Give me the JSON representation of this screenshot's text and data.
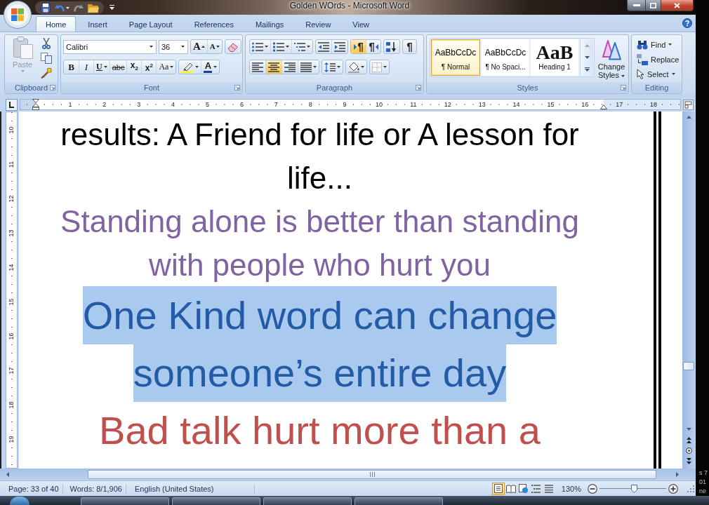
{
  "window": {
    "title": "Golden WOrds - Microsoft Word"
  },
  "quick_access": [
    {
      "kind": "save",
      "disabled": false,
      "dropdown": false
    },
    {
      "kind": "undo",
      "disabled": false,
      "dropdown": true
    },
    {
      "kind": "redo",
      "disabled": true,
      "dropdown": false
    },
    {
      "kind": "open",
      "disabled": false,
      "dropdown": false
    }
  ],
  "tabs": [
    {
      "label": "Home",
      "selected": true
    },
    {
      "label": "Insert",
      "selected": false
    },
    {
      "label": "Page Layout",
      "selected": false
    },
    {
      "label": "References",
      "selected": false
    },
    {
      "label": "Mailings",
      "selected": false
    },
    {
      "label": "Review",
      "selected": false
    },
    {
      "label": "View",
      "selected": false
    }
  ],
  "ribbon": {
    "clipboard": {
      "label": "Clipboard",
      "paste": {
        "label": "Paste",
        "disabled": true
      }
    },
    "font": {
      "label": "Font",
      "font_name": "Calibri",
      "font_size": "36",
      "size_buttons": [
        {
          "kind": "grow",
          "text": "A"
        },
        {
          "kind": "shrink",
          "text": "A"
        }
      ],
      "format_buttons": [
        {
          "kind": "bold",
          "text": "B",
          "dropdown": false
        },
        {
          "kind": "italic",
          "text": "I",
          "dropdown": false
        },
        {
          "kind": "underline",
          "text": "U",
          "dropdown": true
        },
        {
          "kind": "strikethrough",
          "text": "abc",
          "dropdown": false
        },
        {
          "kind": "subscript",
          "text": "x$_{2}$",
          "dropdown": false
        },
        {
          "kind": "superscript",
          "text": "x$^{2}$",
          "dropdown": false
        },
        {
          "kind": "change_case",
          "text": "Aa",
          "dropdown": true
        }
      ],
      "font_color": {
        "text": "A"
      }
    },
    "paragraph": {
      "label": "Paragraph",
      "rows": [
        [
          [
            {
              "kind": "bullets",
              "dropdown": true,
              "selected": false
            },
            {
              "kind": "numbering",
              "dropdown": true,
              "selected": false
            },
            {
              "kind": "multilevel",
              "dropdown": true,
              "selected": false
            }
          ],
          [
            {
              "kind": "decrease_indent",
              "dropdown": false,
              "selected": false
            },
            {
              "kind": "increase_indent",
              "dropdown": false,
              "selected": false
            }
          ],
          [
            {
              "kind": "left_to_right",
              "dropdown": false,
              "selected": true
            },
            {
              "kind": "right_to_left",
              "dropdown": false,
              "selected": false
            }
          ],
          [
            {
              "kind": "sort",
              "dropdown": false,
              "selected": false
            }
          ],
          [
            {
              "kind": "show_marks",
              "dropdown": false,
              "selected": false
            }
          ]
        ],
        [
          [
            {
              "kind": "align_left",
              "dropdown": false,
              "selected": false
            },
            {
              "kind": "align_center",
              "dropdown": false,
              "selected": true
            },
            {
              "kind": "align_right",
              "dropdown": false,
              "selected": false
            },
            {
              "kind": "justify",
              "dropdown": true,
              "selected": false
            }
          ],
          [
            {
              "kind": "line_spacing",
              "dropdown": true,
              "selected": false
            }
          ],
          [
            {
              "kind": "shading",
              "dropdown": true,
              "selected": false
            }
          ],
          [
            {
              "kind": "borders",
              "dropdown": true,
              "selected": false
            }
          ]
        ]
      ]
    },
    "styles": {
      "label": "Styles",
      "gallery": [
        {
          "kind": "body",
          "preview": "AaBbCcDc",
          "name": "¶ Normal",
          "selected": true
        },
        {
          "kind": "body",
          "preview": "AaBbCcDc",
          "name": "¶ No Spaci...",
          "selected": false
        },
        {
          "kind": "heading",
          "preview": "AaB",
          "name": "Heading 1",
          "selected": false
        }
      ],
      "change_styles": "Change Styles"
    },
    "editing": {
      "label": "Editing",
      "buttons": [
        {
          "kind": "find",
          "label": "Find",
          "dropdown": true
        },
        {
          "kind": "replace",
          "label": "Replace",
          "dropdown": false
        },
        {
          "kind": "select",
          "label": "Select",
          "dropdown": true
        }
      ]
    }
  },
  "ruler": {
    "horizontal": [
      "1",
      "2",
      "3",
      "4",
      "5",
      "6",
      "7",
      "8",
      "9",
      "10",
      "11",
      "12",
      "13",
      "14",
      "15",
      "16",
      "17",
      "18"
    ],
    "vertical": [
      "10",
      "11",
      "12",
      "13",
      "14",
      "15",
      "16",
      "17",
      "18",
      "19"
    ]
  },
  "document": {
    "paragraphs": [
      {
        "kind": "regular",
        "color": "#000000",
        "selected": false,
        "lines": [
          "results: A Friend for life or A lesson for",
          "life..."
        ]
      },
      {
        "kind": "regular",
        "color": "#8064a2",
        "selected": false,
        "lines": [
          "Standing alone is better than standing",
          "with people who hurt you"
        ]
      },
      {
        "kind": "large",
        "color": "#245ba7",
        "selected": true,
        "lines": [
          "One Kind word can change",
          "someone’s entire day"
        ]
      },
      {
        "kind": "large",
        "color": "#c0504d",
        "selected": false,
        "lines": [
          "Bad talk hurt more than a"
        ]
      }
    ]
  },
  "status_bar": {
    "page": "Page: 33 of 40",
    "words": "Words: 8/1,906",
    "language": "English (United States)",
    "views": [
      {
        "kind": "print_layout",
        "selected": true
      },
      {
        "kind": "full_screen_reading",
        "selected": false
      },
      {
        "kind": "web_layout",
        "selected": false
      },
      {
        "kind": "outline",
        "selected": false
      },
      {
        "kind": "draft",
        "selected": false
      }
    ],
    "zoom": {
      "reading": "130%",
      "level": 0.52
    }
  },
  "desktop": {
    "fragments": [
      "s 7",
      "01",
      "ne"
    ]
  }
}
